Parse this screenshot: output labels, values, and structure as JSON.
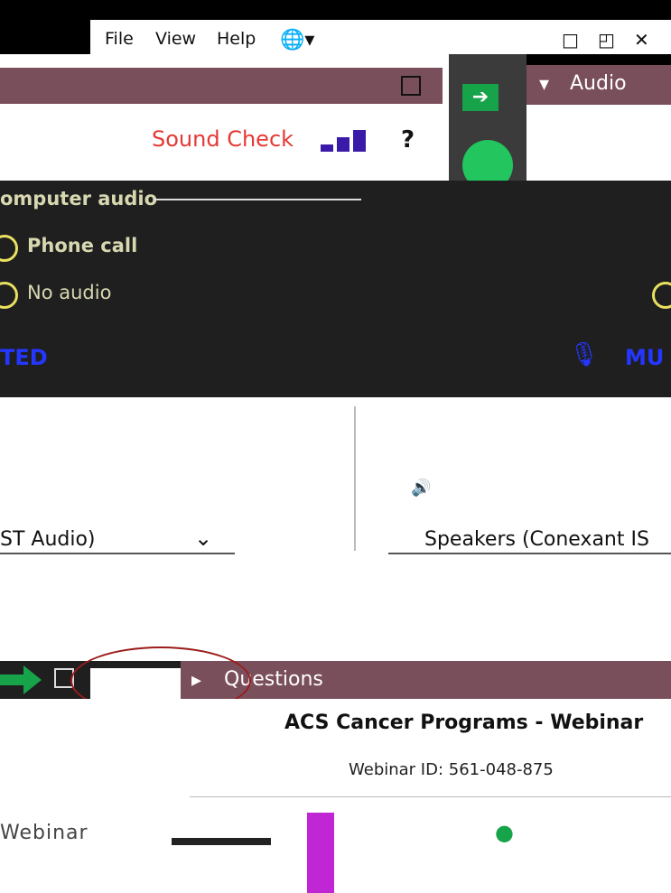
{
  "menubar": {
    "items": [
      "File",
      "View",
      "Help"
    ],
    "globe_icon": "globe-icon"
  },
  "window_controls": [
    "restore-icon",
    "popout-icon",
    "close-icon"
  ],
  "audio_panel": {
    "header": "Audio",
    "sound_check": "Sound Check",
    "help": "?",
    "options": [
      "omputer audio",
      "Phone call",
      "No audio"
    ],
    "muted_left": "TED",
    "muted_right": "MU",
    "microphone": "ST Audio)",
    "speakers": "Speakers (Conexant IS"
  },
  "questions": {
    "header": "Questions"
  },
  "webinar": {
    "title": "ACS Cancer Programs - Webinar",
    "id_line": "Webinar ID: 561-048-875",
    "brand_text": "Webinar"
  },
  "colors": {
    "panel_header": "#7a4f5c",
    "accent_green": "#16a34a",
    "sound_check_red": "#e53935",
    "muted_blue": "#2436ff"
  }
}
